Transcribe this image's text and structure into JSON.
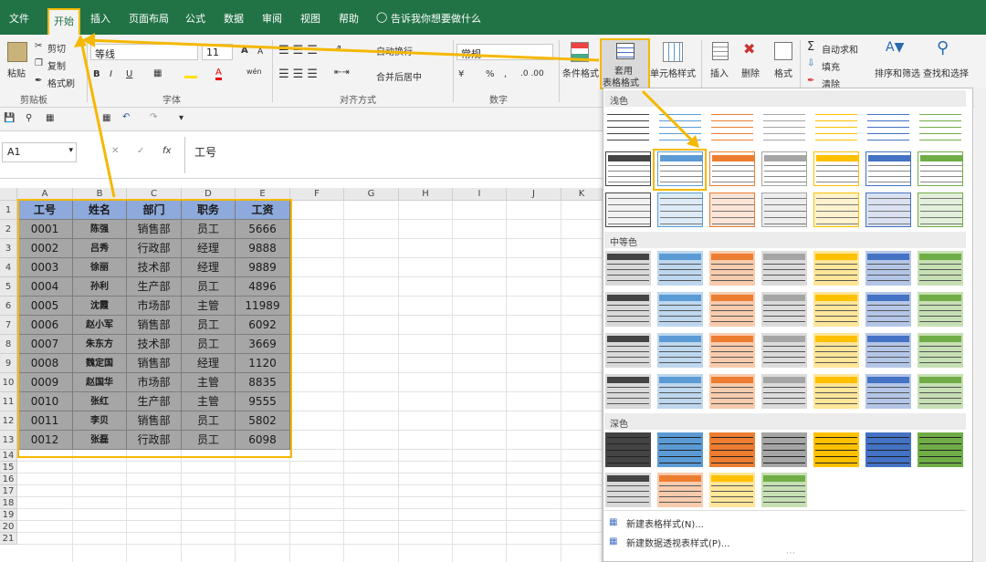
{
  "menubar": {
    "tabs": [
      "文件",
      "开始",
      "插入",
      "页面布局",
      "公式",
      "数据",
      "审阅",
      "视图",
      "帮助"
    ],
    "tell_me": "告诉我你想要做什么"
  },
  "clipboard": {
    "paste": "粘贴",
    "cut": "剪切",
    "copy": "复制",
    "format_painter": "格式刷",
    "group": "剪贴板"
  },
  "font": {
    "name": "等线",
    "size": "11",
    "group": "字体",
    "bold": "B",
    "italic": "I",
    "underline": "U",
    "grow": "A",
    "shrink": "A",
    "color": "A",
    "wen": "wén"
  },
  "alignment": {
    "wrap": "自动换行",
    "merge": "合并后居中",
    "group": "对齐方式"
  },
  "number": {
    "format": "常规",
    "percent": "%",
    "comma": ",",
    "group": "数字"
  },
  "styles": {
    "conditional": "条件格式",
    "table_style_1": "套用",
    "table_style_2": "表格格式",
    "cell_style": "单元格样式"
  },
  "cells": {
    "insert": "插入",
    "delete": "删除",
    "format": "格式"
  },
  "editing": {
    "autosum": "自动求和",
    "fill": "填充",
    "clear": "清除",
    "sort": "排序和筛选",
    "find": "查找和选择"
  },
  "formula_bar": {
    "name_box": "A1",
    "fx": "fx",
    "content": "工号"
  },
  "columns": [
    "A",
    "B",
    "C",
    "D",
    "E",
    "F",
    "G",
    "H",
    "I",
    "J",
    "K"
  ],
  "rows": [
    "1",
    "2",
    "3",
    "4",
    "5",
    "6",
    "7",
    "8",
    "9",
    "10",
    "11",
    "12",
    "13",
    "14",
    "15",
    "16",
    "17",
    "18",
    "19",
    "20",
    "21"
  ],
  "table": {
    "headers": [
      "工号",
      "姓名",
      "部门",
      "职务",
      "工资"
    ],
    "rows": [
      [
        "0001",
        "陈强",
        "销售部",
        "员工",
        "5666"
      ],
      [
        "0002",
        "吕秀",
        "行政部",
        "经理",
        "9888"
      ],
      [
        "0003",
        "徐丽",
        "技术部",
        "经理",
        "9889"
      ],
      [
        "0004",
        "孙利",
        "生产部",
        "员工",
        "4896"
      ],
      [
        "0005",
        "沈霞",
        "市场部",
        "主管",
        "11989"
      ],
      [
        "0006",
        "赵小军",
        "销售部",
        "员工",
        "6092"
      ],
      [
        "0007",
        "朱东方",
        "技术部",
        "员工",
        "3669"
      ],
      [
        "0008",
        "魏定国",
        "销售部",
        "经理",
        "1120"
      ],
      [
        "0009",
        "赵国华",
        "市场部",
        "主管",
        "8835"
      ],
      [
        "0010",
        "张红",
        "生产部",
        "主管",
        "9555"
      ],
      [
        "0011",
        "李贝",
        "销售部",
        "员工",
        "5802"
      ],
      [
        "0012",
        "张磊",
        "行政部",
        "员工",
        "6098"
      ]
    ]
  },
  "gallery": {
    "sections": [
      "浅色",
      "中等色",
      "深色"
    ],
    "new_table_style": "新建表格样式(N)...",
    "new_pivot_style": "新建数据透视表样式(P)...",
    "palette": [
      "#444444",
      "#5b9bd5",
      "#ed7d31",
      "#a5a5a5",
      "#ffc000",
      "#4472c4",
      "#70ad47"
    ]
  },
  "colors": {
    "brand": "#217346",
    "highlight": "#f5b800",
    "table_fill": "#a6a6a6"
  }
}
